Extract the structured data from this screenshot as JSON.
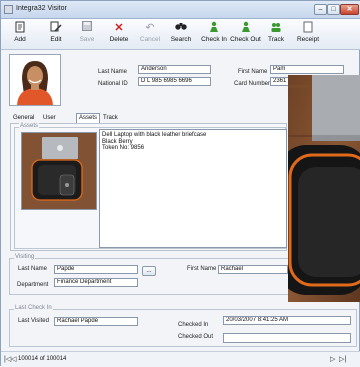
{
  "window": {
    "title": "Integra32 Visitor",
    "minimize": "–",
    "maximize": "□",
    "close": "✕"
  },
  "toolbar": {
    "add": "Add",
    "edit": "Edit",
    "save": "Save",
    "delete": "Delete",
    "cancel": "Cancel",
    "search": "Search",
    "check_in": "Check In",
    "check_out": "Check Out",
    "track": "Track",
    "receipt": "Receipt"
  },
  "visitor": {
    "last_name_label": "Last Name",
    "last_name": "Anderson",
    "national_id_label": "National ID",
    "national_id": "D L 985 6985 6696",
    "first_name_label": "First Name",
    "first_name": "Pam",
    "card_number_label": "Card Number",
    "card_number": "2361"
  },
  "tabs": [
    "General",
    "User Fields",
    "Assets",
    "Track"
  ],
  "assets": {
    "group_title": "Assets",
    "notes": [
      "Dell Laptop with black leather briefcase",
      "Black Berry",
      "Token No: 9856"
    ]
  },
  "visiting": {
    "group_title": "Visiting",
    "last_name_label": "Last Name",
    "last_name": "Papde",
    "department_label": "Department",
    "department": "Finance Department",
    "lookup": "...",
    "first_name_label": "First Name",
    "first_name": "Rachael"
  },
  "last_check_in": {
    "group_title": "Last Check In",
    "last_visited_label": "Last Visited",
    "last_visited": "Rachael Papde",
    "checked_in_label": "Checked In",
    "checked_in": "20/03/2007 8:41:25 AM",
    "checked_out_label": "Checked Out",
    "checked_out": ""
  },
  "navigator": {
    "first": "|◁",
    "prev": "◁",
    "record_text": "100014 of 100014",
    "next": "▷",
    "last": "▷|"
  },
  "colors": {
    "accent": "#e06a1a",
    "delete_red": "#d21f1f",
    "check_green": "#3b9a2f"
  }
}
